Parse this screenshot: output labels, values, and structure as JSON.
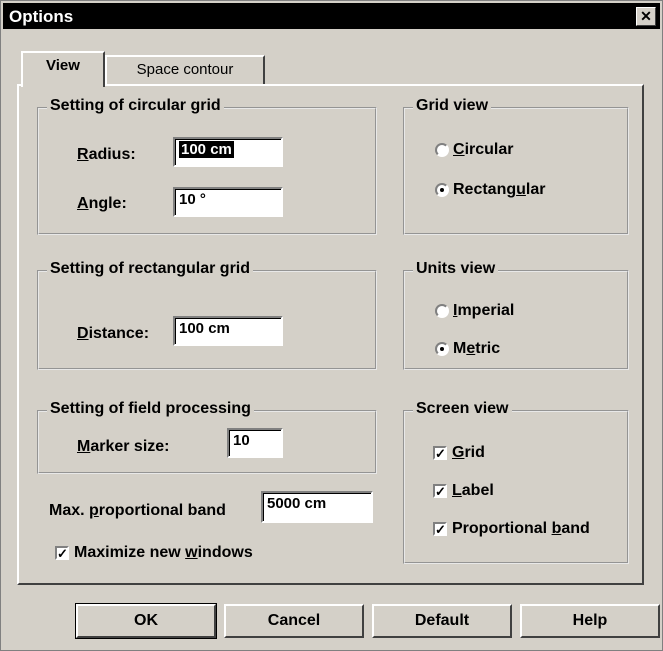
{
  "window": {
    "title": "Options",
    "close_glyph": "✕"
  },
  "tabs": [
    {
      "label": "View",
      "active": true
    },
    {
      "label": "Space contour",
      "active": false
    }
  ],
  "circular_grid": {
    "title": "Setting of circular grid",
    "radius_label_u": "R",
    "radius_label_rest": "adius:",
    "radius_value": "100 cm",
    "angle_label_u": "A",
    "angle_label_rest": "ngle:",
    "angle_value": "10 °"
  },
  "grid_view": {
    "title": "Grid view",
    "circular_u": "C",
    "circular_rest": "ircular",
    "rect_pre": "Rectang",
    "rect_u": "u",
    "rect_post": "lar",
    "selected": "Rectangular"
  },
  "rect_grid": {
    "title": "Setting of rectangular grid",
    "distance_label_u": "D",
    "distance_label_rest": "istance:",
    "distance_value": "100 cm"
  },
  "units_view": {
    "title": "Units view",
    "imperial_u": "I",
    "imperial_rest": "mperial",
    "metric_pre": "M",
    "metric_u": "e",
    "metric_post": "tric",
    "selected": "Metric"
  },
  "field_processing": {
    "title": "Setting of field processing",
    "marker_label_u": "M",
    "marker_label_rest": "arker size:",
    "marker_value": "10"
  },
  "screen_view": {
    "title": "Screen view",
    "grid_u": "G",
    "grid_rest": "rid",
    "grid_checked": true,
    "label_u": "L",
    "label_rest": "abel",
    "label_checked": true,
    "band_pre": "Proportional ",
    "band_u": "b",
    "band_post": "and",
    "band_checked": true
  },
  "prop_band": {
    "label_pre": "Max. ",
    "label_u": "p",
    "label_post": "roportional band",
    "value": "5000 cm"
  },
  "maximize": {
    "label_pre": "Maximize new ",
    "label_u": "w",
    "label_post": "indows",
    "checked": true
  },
  "buttons": {
    "ok": "OK",
    "cancel": "Cancel",
    "default": "Default",
    "help": "Help"
  },
  "check_glyph": "✓"
}
